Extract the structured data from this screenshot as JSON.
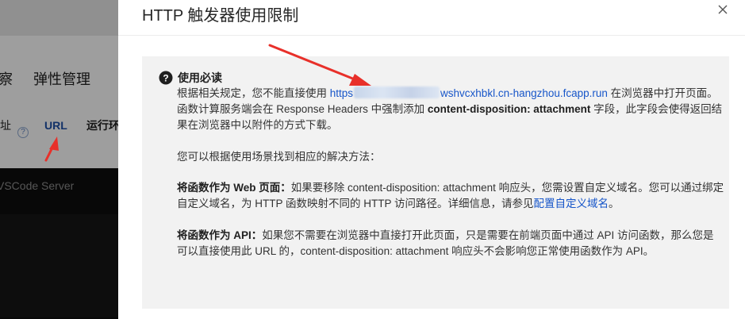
{
  "background": {
    "tab_partial": "察",
    "tab_elastic": "弹性管理",
    "address_partial": "址",
    "url_tab": "URL",
    "run_partial": "运行环",
    "server_text": "VSCode Server"
  },
  "drawer": {
    "title": "HTTP 触发器使用限制",
    "notice_title": "使用必读",
    "p1_a": "根据相关规定，您不能直接使用 ",
    "p1_link_a": "https",
    "p1_link_b": "wshvcxhbkl.cn-hangzhou.fcapp.run",
    "p1_b": " 在浏览器中打开页面。函数计算服务端会在 Response Headers 中强制添加 ",
    "p1_bold": "content-disposition: attachment",
    "p1_c": " 字段，此字段会使得返回结果在浏览器中以附件的方式下载。",
    "p2": "您可以根据使用场景找到相应的解决方法：",
    "p3_bold": "将函数作为 Web 页面：",
    "p3_text": "如果要移除 content-disposition: attachment 响应头，您需设置自定义域名。您可以通过绑定自定义域名，为 HTTP 函数映射不同的 HTTP 访问路径。详细信息，请参见",
    "p3_link": "配置自定义域名",
    "p3_end": "。",
    "p4_bold": "将函数作为 API：",
    "p4_text": "如果您不需要在浏览器中直接打开此页面，只是需要在前端页面中通过 API 访问函数，那么您是可以直接使用此 URL 的，content-disposition: attachment 响应头不会影响您正常使用函数作为 API。"
  },
  "colors": {
    "link": "#1756c9",
    "annotation_arrow": "#e8302a",
    "notice_bg": "#f2f2f2"
  }
}
